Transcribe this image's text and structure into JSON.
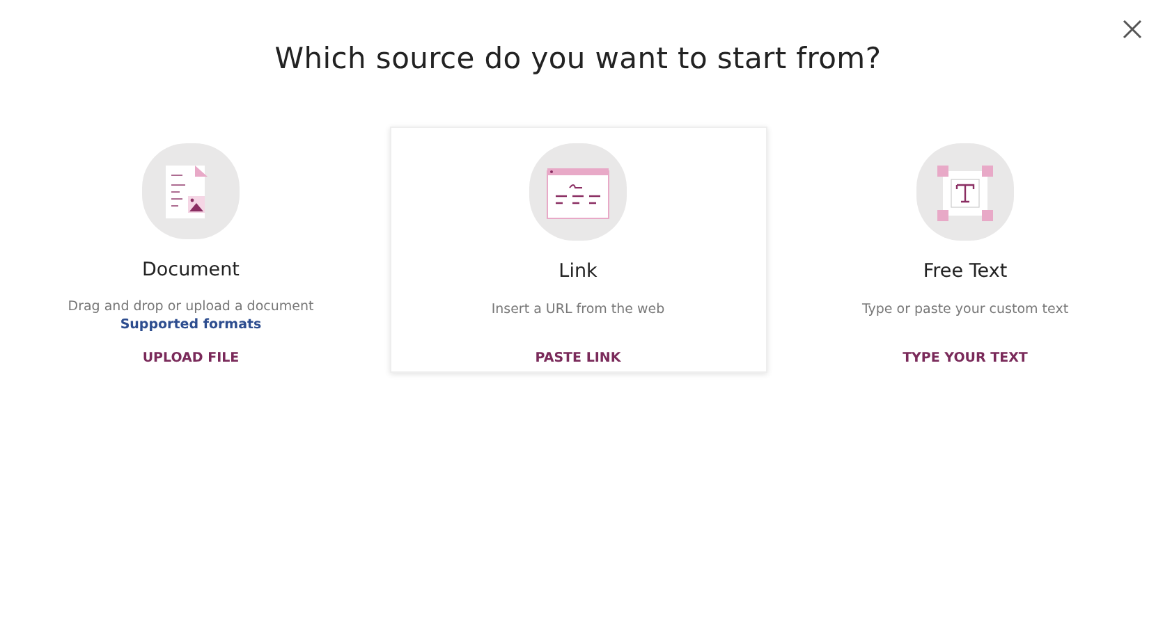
{
  "heading": "Which source do you want to start from?",
  "options": [
    {
      "kind": "document",
      "title": "Document",
      "description": "Drag and drop or upload a document",
      "link": "Supported formats",
      "action": "UPLOAD FILE",
      "highlighted": false
    },
    {
      "kind": "link",
      "title": "Link",
      "description": "Insert a URL from the web",
      "action": "PASTE LINK",
      "highlighted": true
    },
    {
      "kind": "text",
      "title": "Free Text",
      "description": "Type or paste your custom text",
      "action": "TYPE YOUR TEXT",
      "highlighted": false
    }
  ]
}
